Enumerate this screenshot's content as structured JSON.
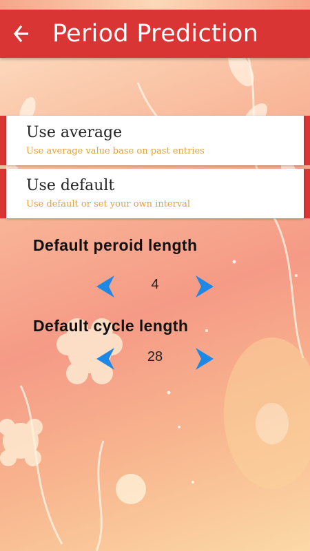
{
  "header": {
    "title": "Period Prediction",
    "back_icon": "arrow-left-icon",
    "bar_color": "#d93535"
  },
  "options": [
    {
      "title": "Use average",
      "subtitle": "Use average value base on past entries"
    },
    {
      "title": "Use default",
      "subtitle": "Use default or set your own interval"
    }
  ],
  "period_length": {
    "label": "Default peroid length",
    "value": "4",
    "decrement_icon": "arrow-left-icon",
    "increment_icon": "arrow-right-icon"
  },
  "cycle_length": {
    "label": "Default cycle length",
    "value": "28",
    "decrement_icon": "arrow-left-icon",
    "increment_icon": "arrow-right-icon"
  },
  "colors": {
    "accent": "#d93535",
    "arrow": "#1e88e5",
    "subtitle": "#e2a23a"
  }
}
